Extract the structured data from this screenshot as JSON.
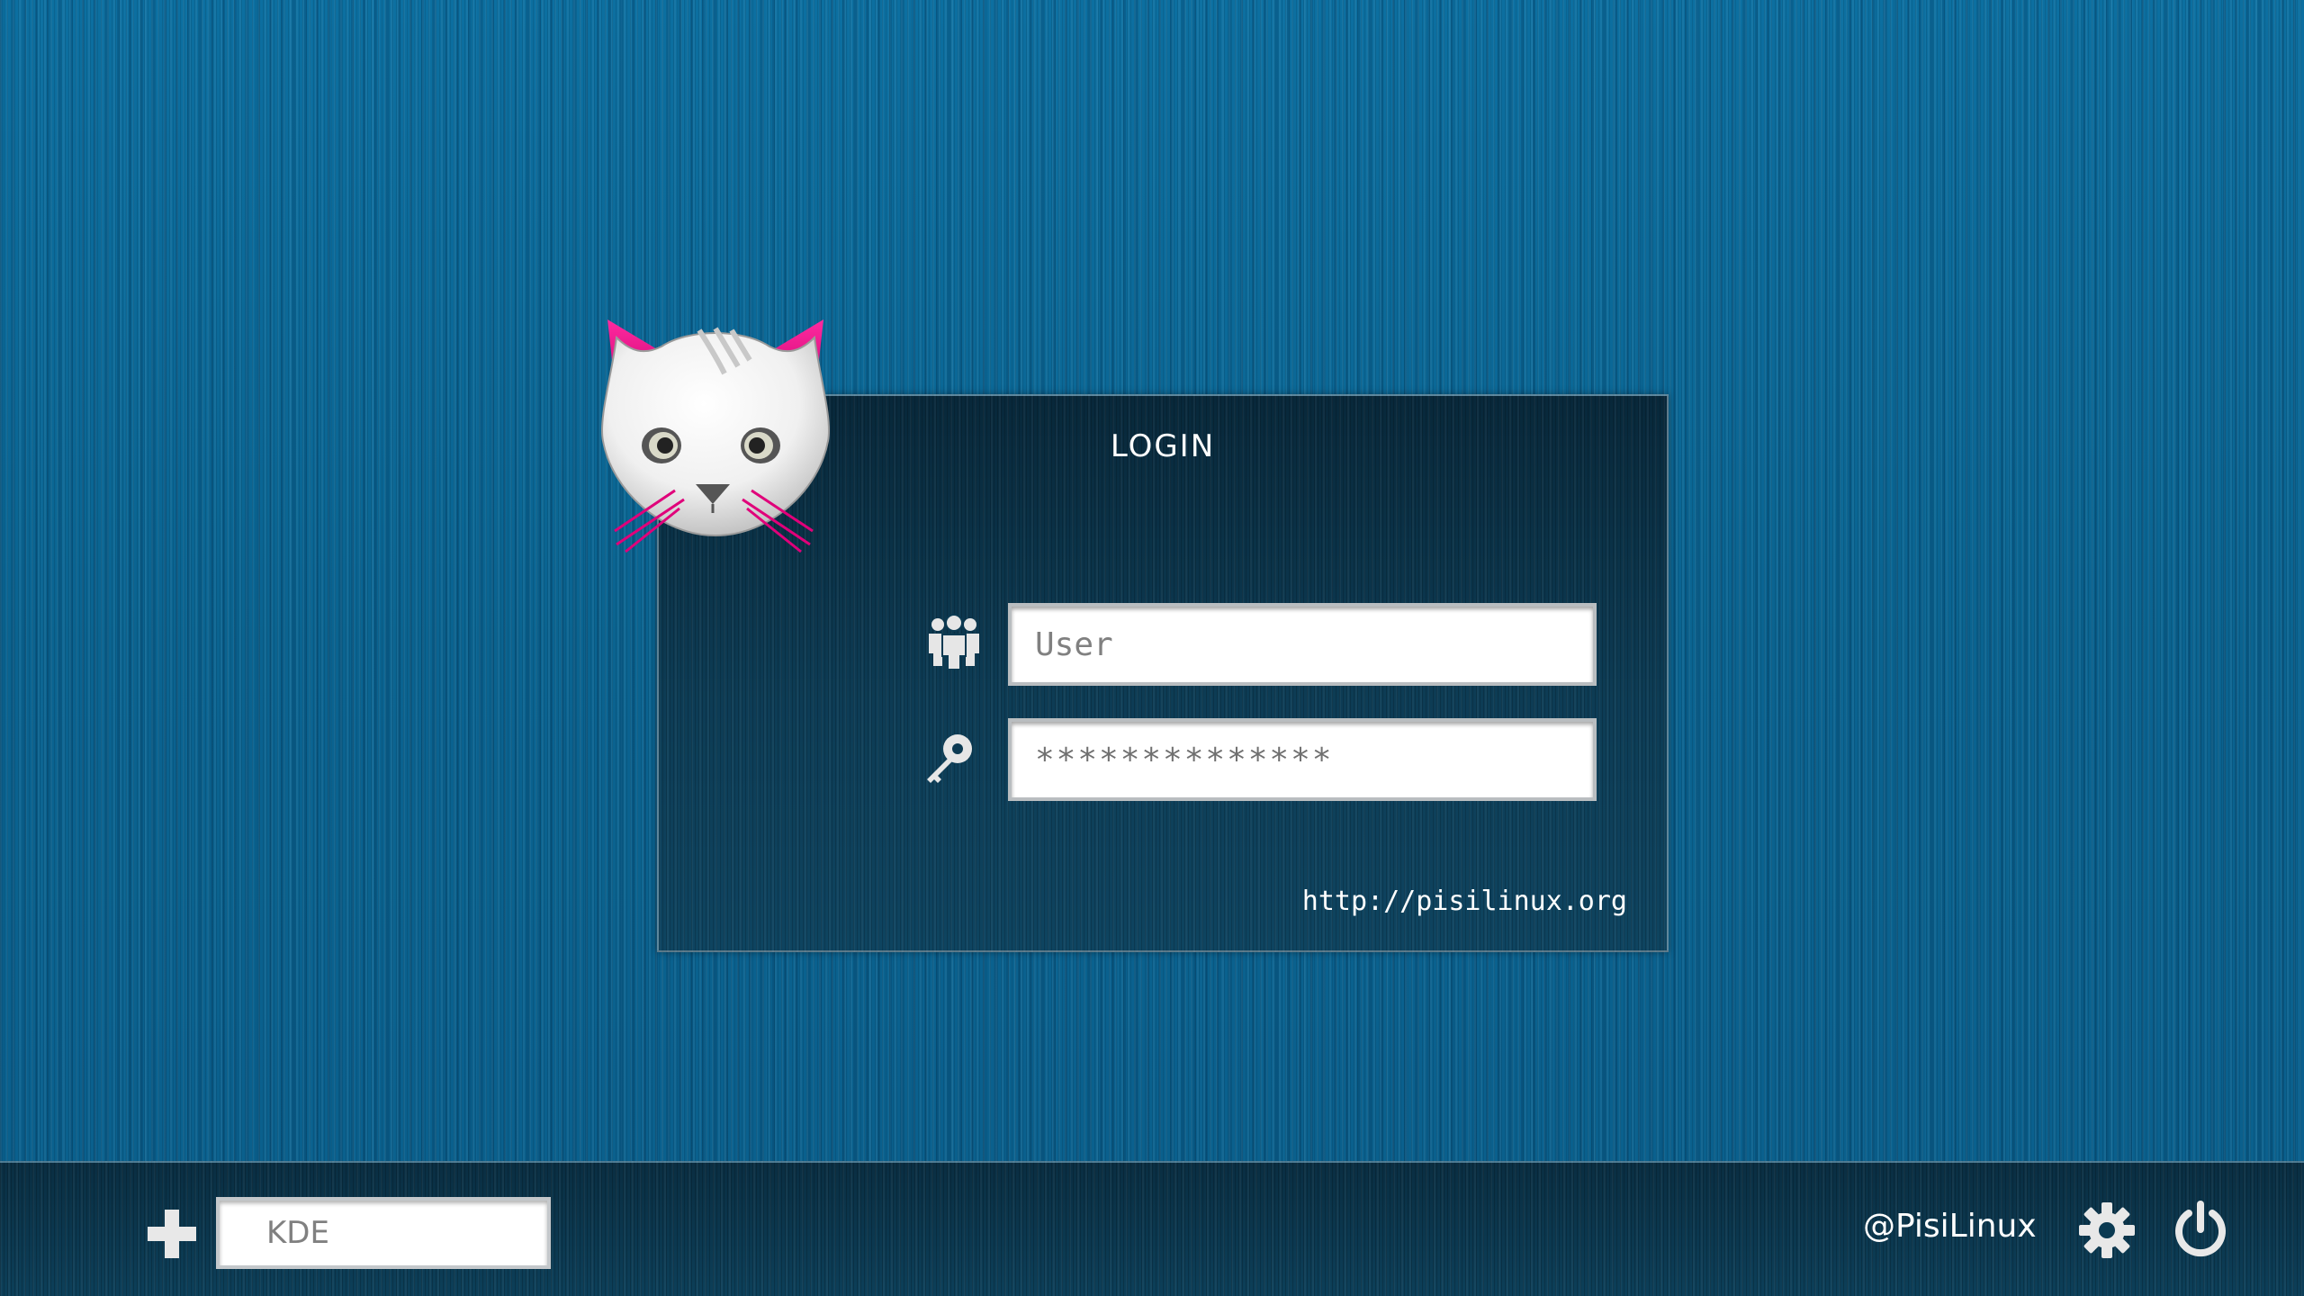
{
  "login": {
    "title": "LOGIN",
    "username_placeholder": "User",
    "password_value": "**************",
    "site_link": "http://pisilinux.org"
  },
  "bottom_bar": {
    "session_value": "KDE",
    "handle": "@PisiLinux"
  },
  "icons": {
    "logo": "cat-logo",
    "user": "users-icon",
    "password": "key-icon",
    "add_session": "plus-icon",
    "settings": "gear-icon",
    "power": "power-icon"
  },
  "colors": {
    "background": "#0a6792",
    "panel": "#0c3a52",
    "accent_magenta": "#e0007a",
    "text": "#ffffff"
  }
}
